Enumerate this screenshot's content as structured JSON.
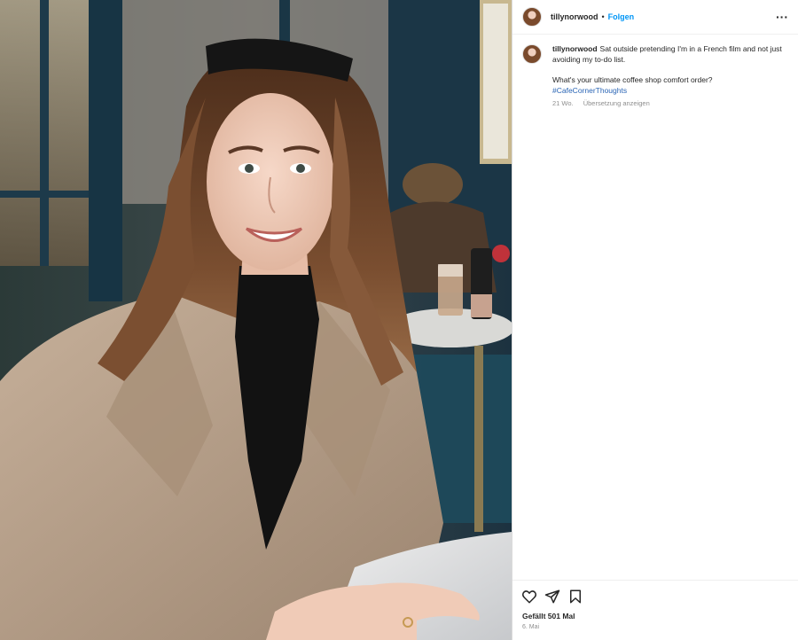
{
  "post": {
    "username": "tillynorwood",
    "separator": "•",
    "follow_label": "Folgen",
    "more_label": "···",
    "caption_text": "Sat outside pretending I'm in a French film and not just avoiding my to-do list.",
    "caption_question": "What's your ultimate coffee shop comfort order?",
    "hashtag": "#CafeCornerThoughts",
    "age": "21 Wo.",
    "translate_label": "Übersetzung anzeigen",
    "likes": "Gefällt 501 Mal",
    "date": "6. Mai"
  },
  "photo": {
    "description": "woman-in-trench-coat-at-cafe-table",
    "colors": {
      "coat": "#b8a08a",
      "hair": "#6b4329",
      "sweater": "#141414",
      "skin": "#f0cdbb",
      "background": "#1f3340",
      "marble": "#dcdcdc"
    }
  },
  "icons": {
    "heart": "heart-icon",
    "share": "paper-plane-icon",
    "save": "bookmark-icon",
    "more": "more-options-icon"
  },
  "colors": {
    "link": "#0095f6",
    "hashtag": "#2a65b5",
    "muted": "#8e8e8e",
    "text": "#262626",
    "border": "#dbdbdb"
  }
}
